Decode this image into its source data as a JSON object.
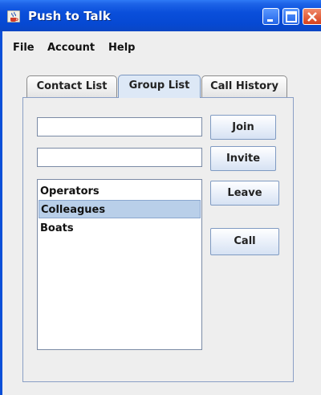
{
  "window": {
    "title": "Push to Talk",
    "title_bar_color": "#0a4fdb",
    "app_icon": "java-cup-icon"
  },
  "menu": {
    "items": [
      "File",
      "Account",
      "Help"
    ]
  },
  "tabs": [
    {
      "label": "Contact List",
      "selected": false
    },
    {
      "label": "Group List",
      "selected": true
    },
    {
      "label": "Call History",
      "selected": false
    }
  ],
  "group_panel": {
    "group_field": {
      "value": "",
      "placeholder": ""
    },
    "invite_field": {
      "value": "",
      "placeholder": ""
    },
    "buttons": {
      "join": "Join",
      "invite": "Invite",
      "leave": "Leave",
      "call": "Call"
    },
    "groups": [
      "Operators",
      "Colleagues",
      "Boats"
    ],
    "selected_group": "Colleagues",
    "selection_color": "#b9cfe9"
  }
}
